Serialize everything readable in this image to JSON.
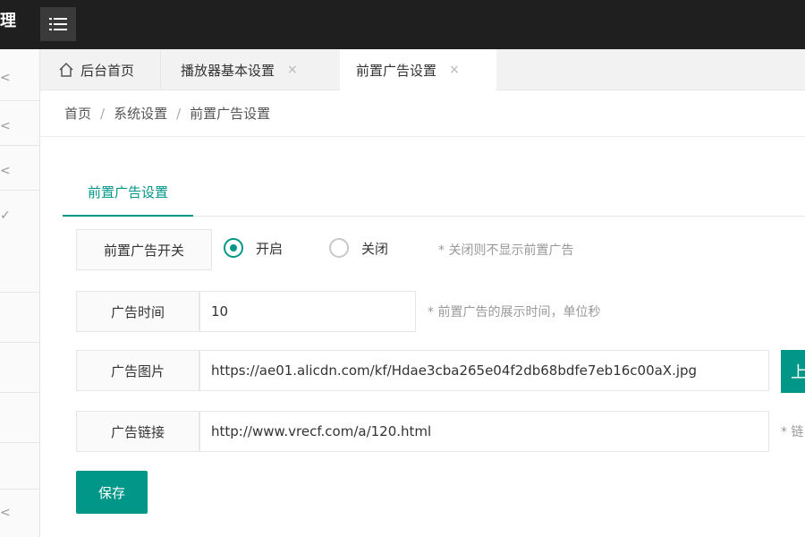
{
  "header": {
    "brand": "理",
    "menu_icon": "hamburger-menu-icon"
  },
  "sidebar": {
    "items": [
      {
        "icon": "chevron-left-icon",
        "glyph": "<"
      },
      {
        "icon": "chevron-left-icon",
        "glyph": "<"
      },
      {
        "icon": "chevron-left-icon",
        "glyph": "<"
      },
      {
        "icon": "check-icon",
        "glyph": "✓"
      },
      {
        "icon": "chevron-left-icon",
        "glyph": "<"
      }
    ]
  },
  "tabs": [
    {
      "label": "后台首页",
      "icon": "home-icon"
    },
    {
      "label": "播放器基本设置",
      "close": "×"
    },
    {
      "label": "前置广告设置",
      "close": "×",
      "active": true
    }
  ],
  "breadcrumb": {
    "items": [
      "首页",
      "系统设置",
      "前置广告设置"
    ],
    "separator": "/"
  },
  "form": {
    "tab_label": "前置广告设置",
    "switch": {
      "label": "前置广告开关",
      "options": [
        "开启",
        "关闭"
      ],
      "selected": "开启",
      "hint": "* 关闭则不显示前置广告"
    },
    "duration": {
      "label": "广告时间",
      "value": "10",
      "hint": "* 前置广告的展示时间，单位秒"
    },
    "image": {
      "label": "广告图片",
      "value": "https://ae01.alicdn.com/kf/Hdae3cba265e04f2db68bdfe7eb16c00aX.jpg",
      "button": "上"
    },
    "link": {
      "label": "广告链接",
      "value": "http://www.vrecf.com/a/120.html",
      "hint": "* 链"
    },
    "save_label": "保存"
  },
  "colors": {
    "accent": "#009688",
    "topbar": "#1f1f1f"
  }
}
